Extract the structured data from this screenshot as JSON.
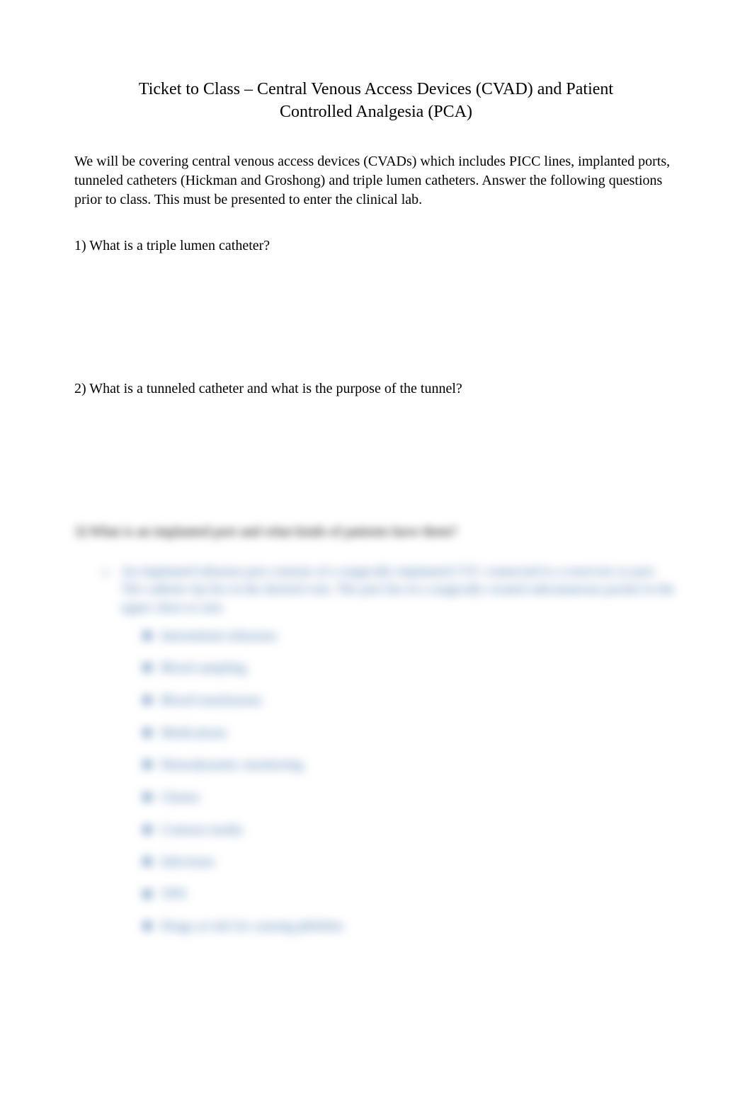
{
  "title": "Ticket to Class – Central Venous Access Devices (CVAD) and Patient Controlled Analgesia (PCA)",
  "intro": "We will be covering central venous access devices (CVADs) which includes PICC lines, implanted ports, tunneled catheters (Hickman and Groshong) and triple lumen catheters. Answer the following questions prior to class.  This must be presented to enter the clinical lab.",
  "questions": {
    "q1": "1) What is a triple lumen catheter?",
    "q2": "2) What is a tunneled catheter and what is the purpose of the tunnel?",
    "q3": "3) What is an implanted port and what kinds of patients have them?"
  },
  "answer3": {
    "main": "An implanted infusion port consists of a surgically implanted CVC connected to a reservoir or port. The catheter tip lies in the desired vein. The port lies in a surgically created subcutaneous pocket in the upper chest or arm.",
    "items": [
      "Intermittent infusions",
      "Blood sampling",
      "Blood transfusions",
      "Medications",
      "Hemodynamic monitoring",
      "Chemo",
      "Contrast media",
      "Infections",
      "TPN",
      "Drugs at risk for causing phlebitis"
    ]
  }
}
